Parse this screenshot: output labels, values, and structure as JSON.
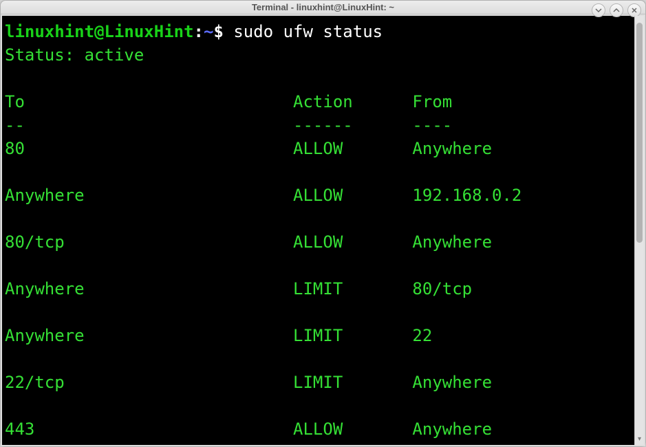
{
  "window": {
    "title": "Terminal - linuxhint@LinuxHint: ~"
  },
  "prompt": {
    "user_host": "linuxhint@LinuxHint",
    "colon": ":",
    "path": "~",
    "dollar": "$"
  },
  "command": "sudo ufw status",
  "status_line": "Status: active",
  "headers": {
    "to": "To",
    "action": "Action",
    "from": "From",
    "to_underline": "--",
    "action_underline": "------",
    "from_underline": "----"
  },
  "rules": [
    {
      "to": "80",
      "action": "ALLOW",
      "from": "Anywhere"
    },
    {
      "to": "Anywhere",
      "action": "ALLOW",
      "from": "192.168.0.2"
    },
    {
      "to": "80/tcp",
      "action": "ALLOW",
      "from": "Anywhere"
    },
    {
      "to": "Anywhere",
      "action": "LIMIT",
      "from": "80/tcp"
    },
    {
      "to": "Anywhere",
      "action": "LIMIT",
      "from": "22"
    },
    {
      "to": "22/tcp",
      "action": "LIMIT",
      "from": "Anywhere"
    },
    {
      "to": "443",
      "action": "ALLOW",
      "from": "Anywhere"
    }
  ],
  "col_widths": {
    "to": 29,
    "action": 12
  }
}
